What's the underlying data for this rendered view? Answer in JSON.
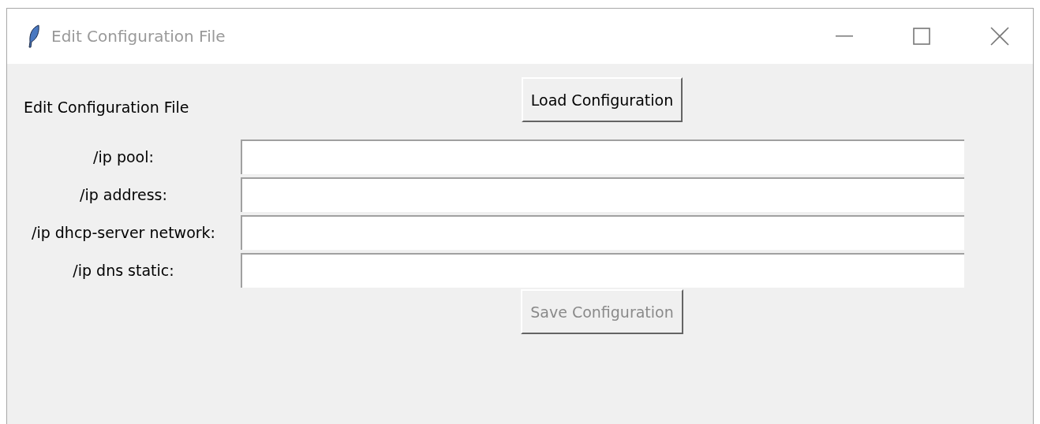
{
  "window": {
    "title": "Edit Configuration File"
  },
  "heading": "Edit Configuration File",
  "load_button": {
    "label": "Load Configuration",
    "disabled": false
  },
  "fields": [
    {
      "label": "/ip pool:"
    },
    {
      "label": "/ip address:"
    },
    {
      "label": "/ip dhcp-server network:"
    },
    {
      "label": "/ip dns static:"
    }
  ],
  "save_button": {
    "label": "Save Configuration",
    "disabled": true
  }
}
